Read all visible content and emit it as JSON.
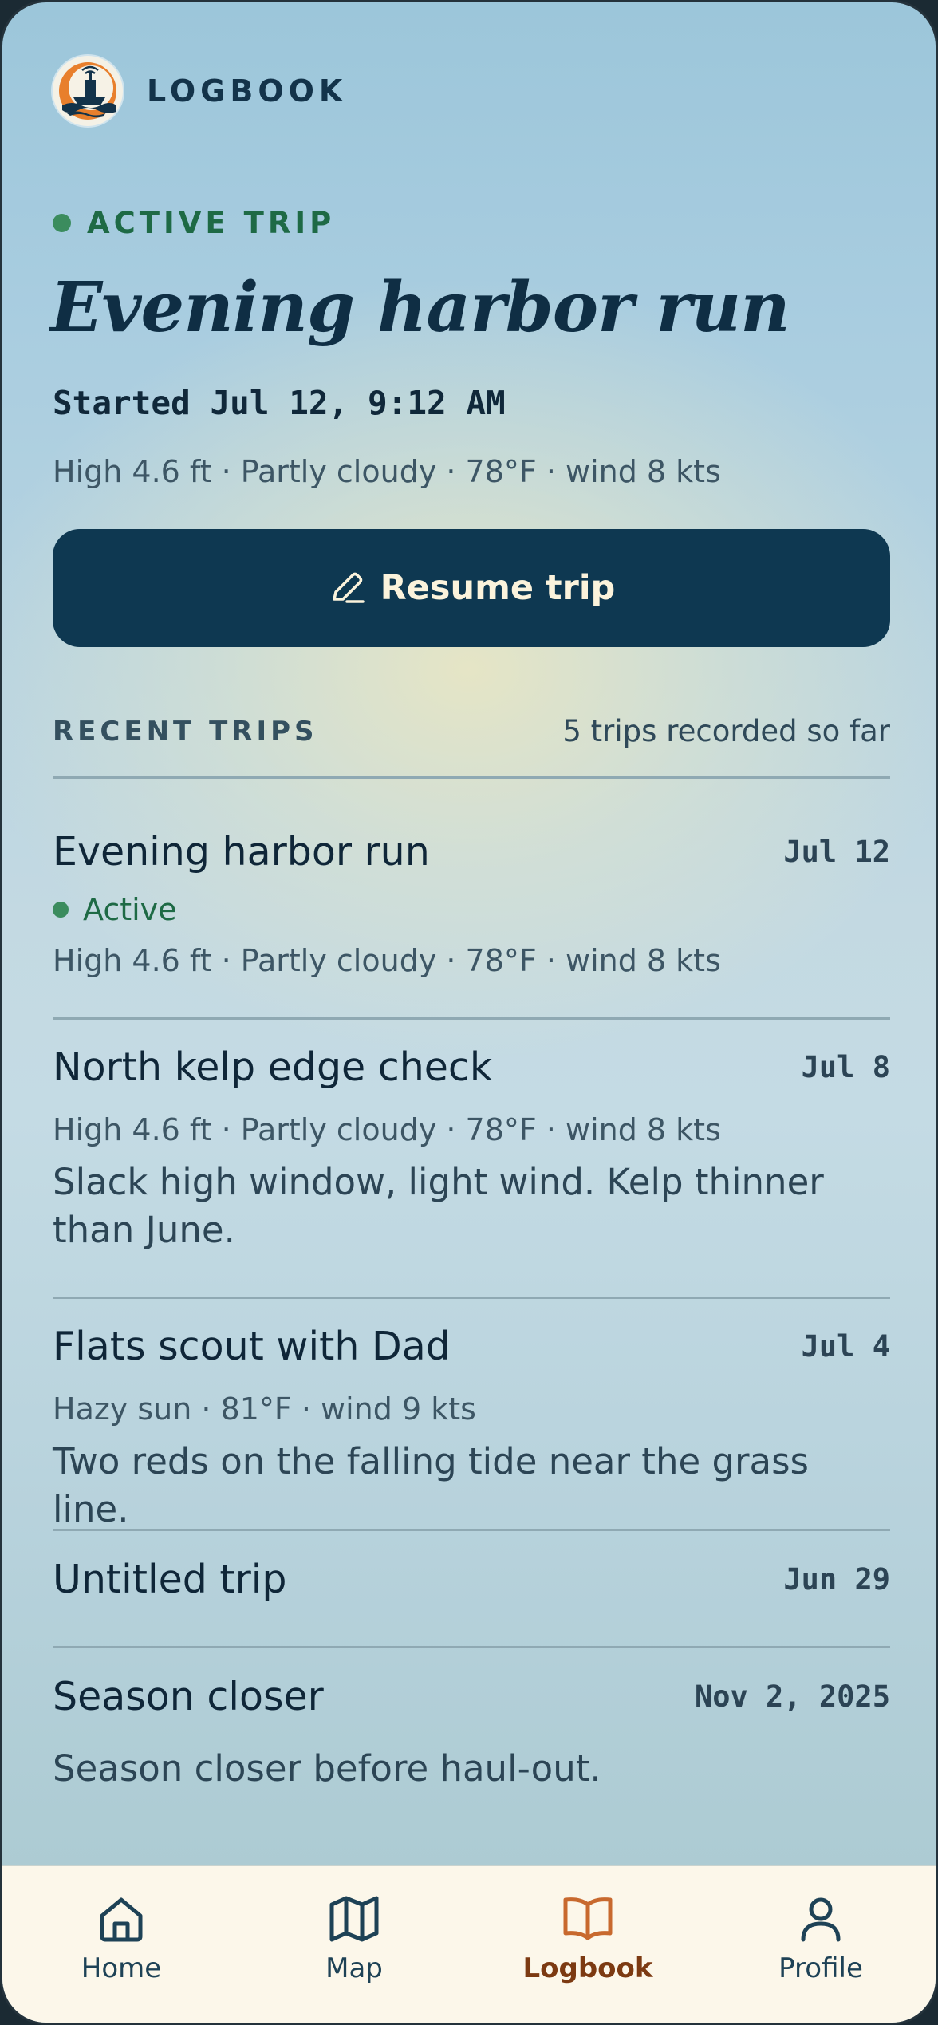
{
  "app": {
    "brand": "LOGBOOK"
  },
  "active_trip": {
    "status": "ACTIVE TRIP",
    "title": "Evening harbor run",
    "started": "Started Jul 12, 9:12 AM",
    "conditions": "High 4.6 ft · Partly cloudy · 78°F · wind 8 kts",
    "resume_label": "Resume trip"
  },
  "recent": {
    "title": "RECENT TRIPS",
    "count": "5 trips recorded so far",
    "trips": [
      {
        "name": "Evening harbor run",
        "date": "Jul 12",
        "status": "Active",
        "meta": "High 4.6 ft · Partly cloudy · 78°F · wind 8 kts"
      },
      {
        "name": "North kelp edge check",
        "date": "Jul 8",
        "meta": "High 4.6 ft · Partly cloudy · 78°F · wind 8 kts",
        "note": "Slack high window, light wind. Kelp thinner than June."
      },
      {
        "name": "Flats scout with Dad",
        "date": "Jul 4",
        "meta": "Hazy sun · 81°F · wind 9 kts",
        "note": "Two reds on the falling tide near the grass line."
      },
      {
        "name": "Untitled trip",
        "date": "Jun 29"
      },
      {
        "name": "Season closer",
        "date": "Nov 2, 2025",
        "note": "Season closer before haul-out."
      }
    ]
  },
  "tabs": [
    {
      "label": "Home",
      "icon": "home-icon"
    },
    {
      "label": "Map",
      "icon": "map-icon"
    },
    {
      "label": "Logbook",
      "icon": "book-icon",
      "active": true
    },
    {
      "label": "Profile",
      "icon": "user-icon"
    }
  ],
  "colors": {
    "accent": "#c8692e",
    "primary": "#0e3851",
    "active_green": "#3b8c5e"
  }
}
